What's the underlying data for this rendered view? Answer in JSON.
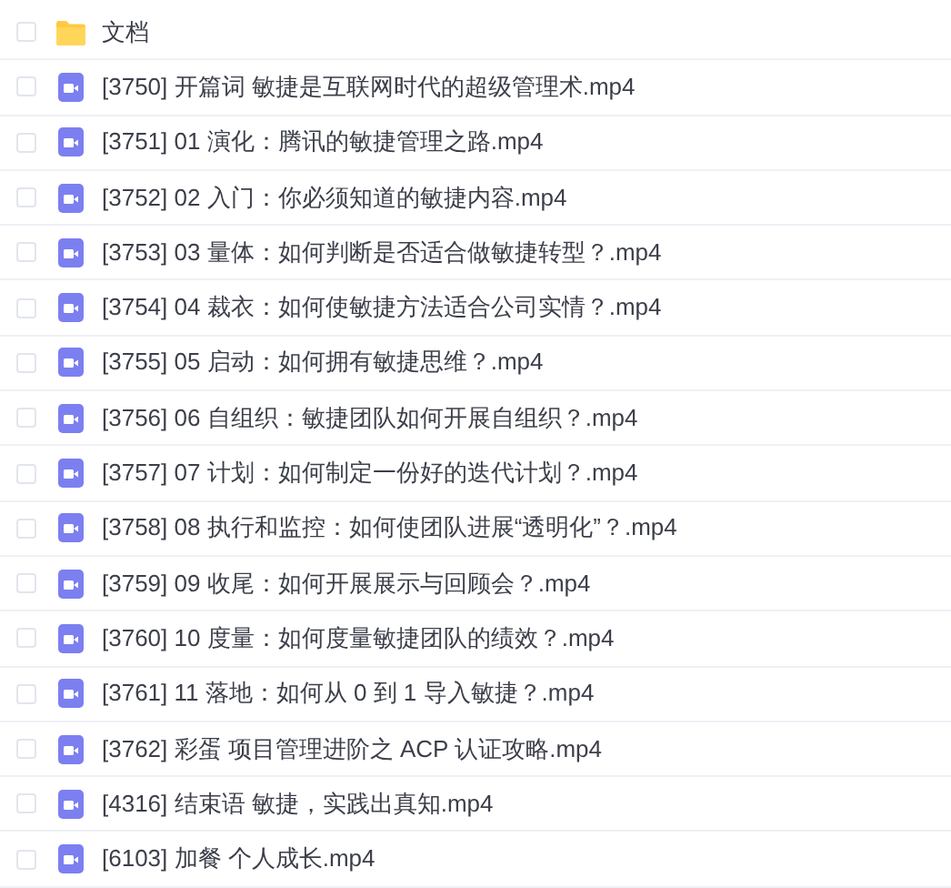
{
  "files": [
    {
      "kind": "folder",
      "name": "文档",
      "checked": false
    },
    {
      "kind": "video",
      "name": "[3750] 开篇词 敏捷是互联网时代的超级管理术.mp4",
      "checked": false
    },
    {
      "kind": "video",
      "name": "[3751] 01 演化：腾讯的敏捷管理之路.mp4",
      "checked": false
    },
    {
      "kind": "video",
      "name": "[3752] 02 入门：你必须知道的敏捷内容.mp4",
      "checked": false
    },
    {
      "kind": "video",
      "name": "[3753] 03 量体：如何判断是否适合做敏捷转型？.mp4",
      "checked": false
    },
    {
      "kind": "video",
      "name": "[3754] 04 裁衣：如何使敏捷方法适合公司实情？.mp4",
      "checked": false
    },
    {
      "kind": "video",
      "name": "[3755] 05 启动：如何拥有敏捷思维？.mp4",
      "checked": false
    },
    {
      "kind": "video",
      "name": "[3756] 06 自组织：敏捷团队如何开展自组织？.mp4",
      "checked": false
    },
    {
      "kind": "video",
      "name": "[3757] 07 计划：如何制定一份好的迭代计划？.mp4",
      "checked": false
    },
    {
      "kind": "video",
      "name": "[3758] 08 执行和监控：如何使团队进展“透明化”？.mp4",
      "checked": false
    },
    {
      "kind": "video",
      "name": "[3759] 09 收尾：如何开展展示与回顾会？.mp4",
      "checked": false
    },
    {
      "kind": "video",
      "name": "[3760] 10 度量：如何度量敏捷团队的绩效？.mp4",
      "checked": false
    },
    {
      "kind": "video",
      "name": "[3761] 11 落地：如何从 0 到 1 导入敏捷？.mp4",
      "checked": false
    },
    {
      "kind": "video",
      "name": "[3762] 彩蛋 项目管理进阶之 ACP 认证攻略.mp4",
      "checked": false
    },
    {
      "kind": "video",
      "name": "[4316] 结束语 敏捷，实践出真知.mp4",
      "checked": false
    },
    {
      "kind": "video",
      "name": "[6103] 加餐 个人成长.mp4",
      "checked": false
    }
  ]
}
